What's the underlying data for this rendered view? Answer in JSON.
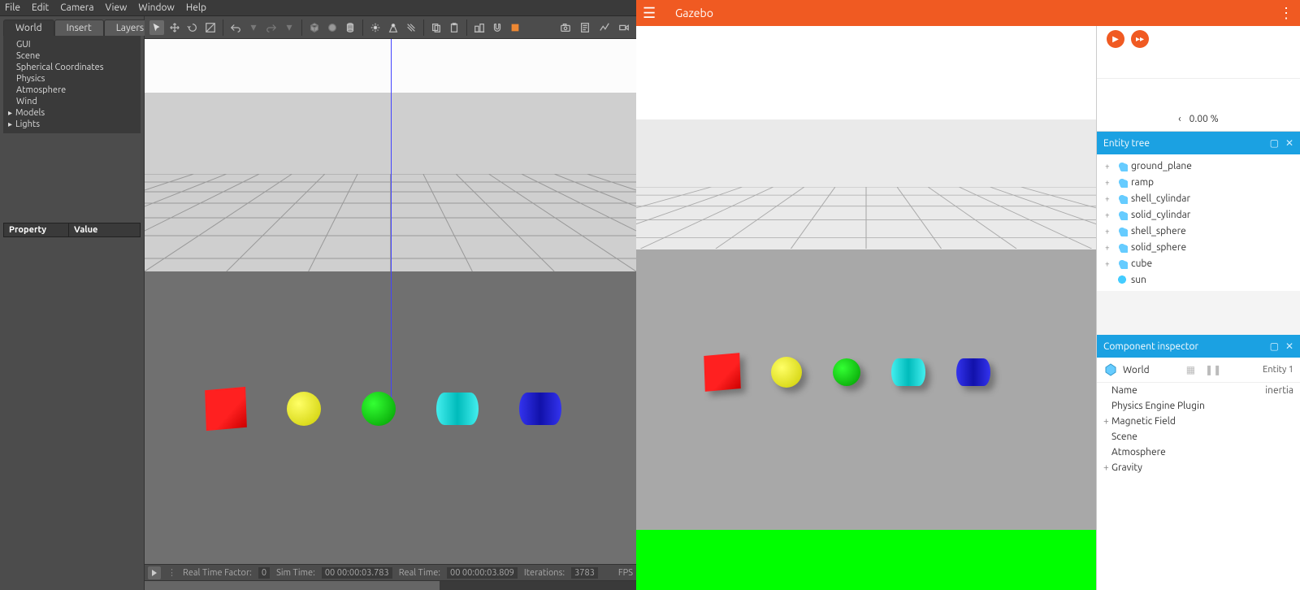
{
  "classic": {
    "menu": [
      "File",
      "Edit",
      "Camera",
      "View",
      "Window",
      "Help"
    ],
    "tabs": [
      "World",
      "Insert",
      "Layers"
    ],
    "active_tab": 0,
    "tree": [
      {
        "label": "GUI",
        "expandable": false
      },
      {
        "label": "Scene",
        "expandable": false
      },
      {
        "label": "Spherical Coordinates",
        "expandable": false
      },
      {
        "label": "Physics",
        "expandable": false
      },
      {
        "label": "Atmosphere",
        "expandable": false
      },
      {
        "label": "Wind",
        "expandable": false
      },
      {
        "label": "Models",
        "expandable": true
      },
      {
        "label": "Lights",
        "expandable": true
      }
    ],
    "prop_headers": [
      "Property",
      "Value"
    ],
    "status": {
      "rtf_label": "Real Time Factor:",
      "rtf_value": "0",
      "sim_label": "Sim Time:",
      "sim_value": "00 00:00:03.783",
      "real_label": "Real Time:",
      "real_value": "00 00:00:03.809",
      "iter_label": "Iterations:",
      "iter_value": "3783",
      "fps_label": "FPS"
    }
  },
  "ignition": {
    "title": "Gazebo",
    "rtf_arrow": "‹",
    "rtf_value": "0.00 %",
    "entity_tree_title": "Entity tree",
    "entities": [
      {
        "name": "ground_plane",
        "type": "model"
      },
      {
        "name": "ramp",
        "type": "model"
      },
      {
        "name": "shell_cylindar",
        "type": "model"
      },
      {
        "name": "solid_cylindar",
        "type": "model"
      },
      {
        "name": "shell_sphere",
        "type": "model"
      },
      {
        "name": "solid_sphere",
        "type": "model"
      },
      {
        "name": "cube",
        "type": "model"
      },
      {
        "name": "sun",
        "type": "light"
      }
    ],
    "comp_title": "Component inspector",
    "world_label": "World",
    "entity_label": "Entity 1",
    "props": [
      {
        "label": "Name",
        "value": "inertia",
        "exp": false
      },
      {
        "label": "Physics Engine Plugin",
        "value": "",
        "exp": false
      },
      {
        "label": "Magnetic Field",
        "value": "",
        "exp": true
      },
      {
        "label": "Scene",
        "value": "",
        "exp": false
      },
      {
        "label": "Atmosphere",
        "value": "",
        "exp": false
      },
      {
        "label": "Gravity",
        "value": "",
        "exp": true
      }
    ]
  }
}
